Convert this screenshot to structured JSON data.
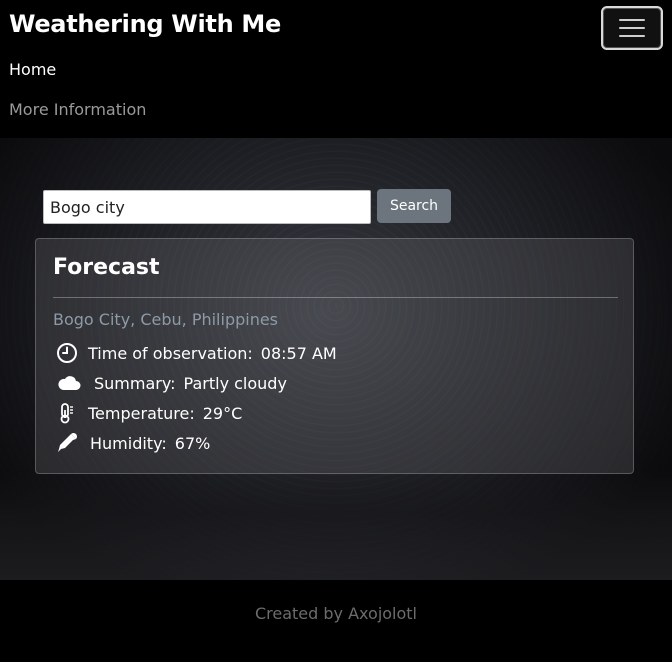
{
  "navbar": {
    "brand": "Weathering With Me",
    "links": [
      "Home",
      "More Information"
    ]
  },
  "search": {
    "value": "Bogo city",
    "button_label": "Search"
  },
  "forecast": {
    "title": "Forecast",
    "location": "Bogo City, Cebu, Philippines",
    "rows": [
      {
        "icon": "clock-icon",
        "label": "Time of observation:",
        "value": "08:57 AM"
      },
      {
        "icon": "cloud-icon",
        "label": "Summary:",
        "value": "Partly cloudy"
      },
      {
        "icon": "thermometer-icon",
        "label": "Temperature:",
        "value": "29°C"
      },
      {
        "icon": "dropper-icon",
        "label": "Humidity:",
        "value": "67%"
      }
    ]
  },
  "footer": {
    "text": "Created by Axojolotl"
  }
}
